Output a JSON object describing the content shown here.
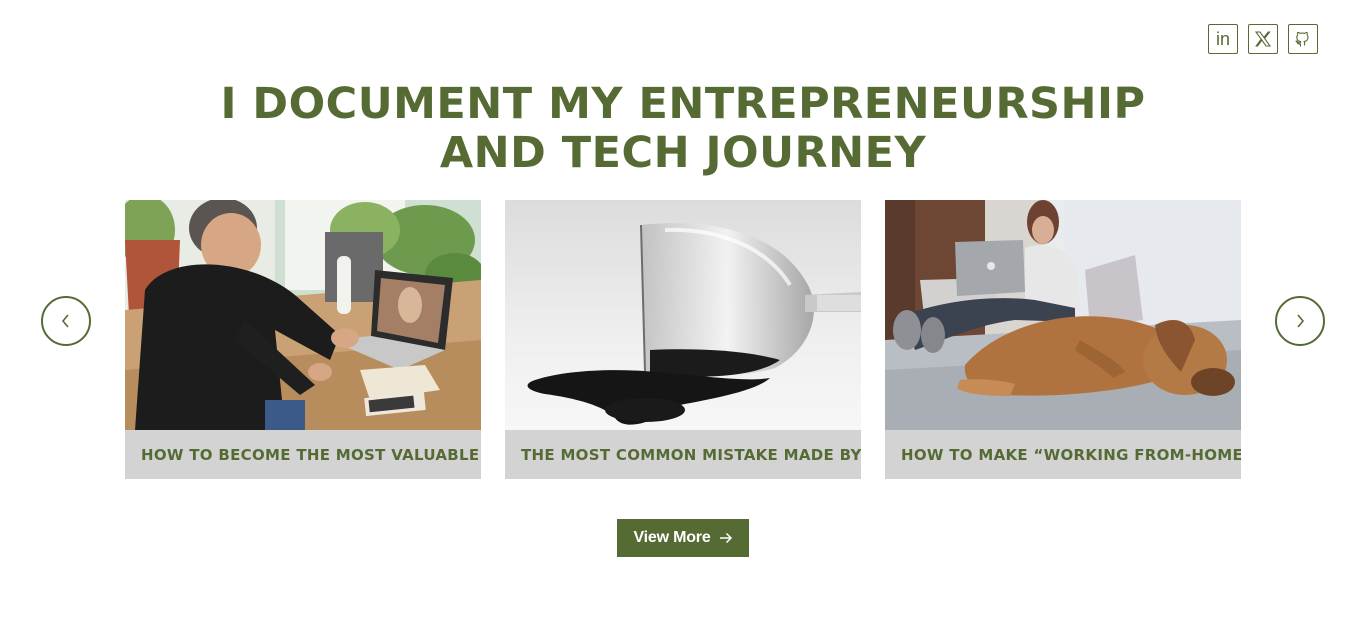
{
  "social": {
    "icons": [
      "linkedin-icon",
      "x-icon",
      "github-icon"
    ],
    "linkedin_label": "in"
  },
  "heading": {
    "line1": "I DOCUMENT MY ENTREPRENEURSHIP",
    "line2": "AND TECH JOURNEY"
  },
  "carousel": {
    "prev_icon": "chevron-left-icon",
    "next_icon": "chevron-right-icon",
    "cards": [
      {
        "title": "HOW TO BECOME THE MOST VALUABLE ...",
        "image": "man-on-video-call-photo"
      },
      {
        "title": "THE MOST COMMON MISTAKE MADE BY ...",
        "image": "spilled-wine-glass-photo"
      },
      {
        "title": "HOW TO MAKE “WORKING FROM-HOME...",
        "image": "woman-with-laptop-and-dog-photo"
      }
    ]
  },
  "view_more": {
    "label": "View More",
    "icon": "arrow-right-icon"
  },
  "colors": {
    "accent": "#566b34",
    "card_bg": "#d3d3d3",
    "background": "#ffffff"
  }
}
